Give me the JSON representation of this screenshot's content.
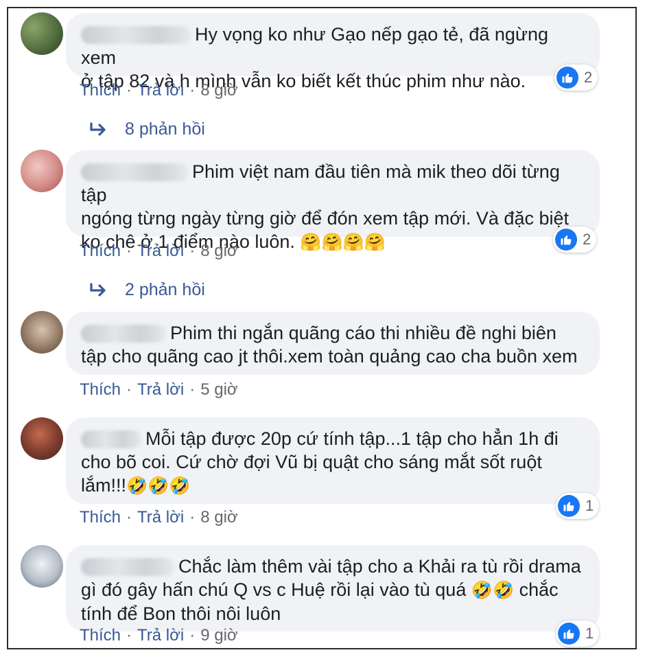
{
  "comments": [
    {
      "text_lines": [
        "Hy vọng ko như Gạo nếp gạo tẻ, đã ngừng xem",
        "ở tập 82 và h mình vẫn ko biết kết thúc phim như nào."
      ],
      "like": "Thích",
      "reply": "Trả lời",
      "time": "8 giờ",
      "reaction_count": "2",
      "replies_label": "8 phản hồi"
    },
    {
      "text_lines": [
        "Phim việt nam đầu tiên mà mik theo dõi từng tập",
        "ngóng từng ngày từng giờ để đón xem tập mới. Và đặc biệt",
        "ko chê ở 1 điểm nào luôn. "
      ],
      "emoji": "🤗🤗🤗🤗",
      "like": "Thích",
      "reply": "Trả lời",
      "time": "8 giờ",
      "reaction_count": "2",
      "replies_label": "2 phản hồi"
    },
    {
      "text_lines": [
        "Phim thi ngắn quãng cáo thi nhiều đề nghi biên",
        "tập cho quãng cao jt thôi.xem toàn quảng cao cha buồn xem"
      ],
      "like": "Thích",
      "reply": "Trả lời",
      "time": "5 giờ"
    },
    {
      "text_lines": [
        "Mỗi tập được 20p cứ tính tập...1 tập cho hẳn 1h đi",
        "cho bõ coi. Cứ chờ đợi Vũ bị quật cho sáng mắt sốt ruột",
        "lắm!!!"
      ],
      "emoji": "🤣🤣🤣",
      "like": "Thích",
      "reply": "Trả lời",
      "time": "8 giờ",
      "reaction_count": "1"
    },
    {
      "text_lines": [
        "Chắc làm thêm vài tập cho a Khải ra tù rồi drama",
        "gì đó gây hấn chú Q vs c Huệ rồi lại vào tù quá ",
        "tính để Bon thôi nôi luôn"
      ],
      "emoji": "🤣🤣",
      "text_after_emoji": " chắc",
      "like": "Thích",
      "reply": "Trả lời",
      "time": "9 giờ",
      "reaction_count": "1"
    }
  ],
  "colors": {
    "link": "#385898",
    "bubble": "#f0f2f5",
    "like_blue": "#1877f2",
    "meta": "#65676b"
  },
  "icons": {
    "like": "thumbs-up-icon",
    "reply_arrow": "reply-arrow-icon"
  }
}
